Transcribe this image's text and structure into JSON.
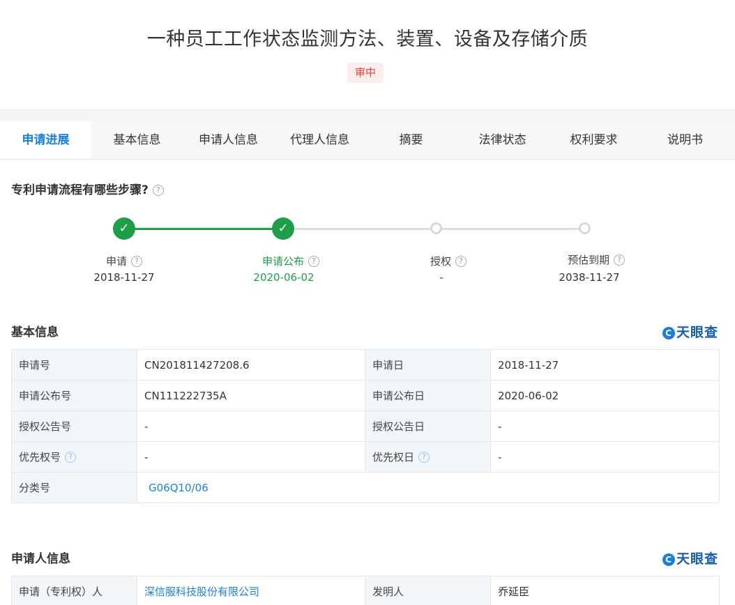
{
  "header": {
    "title": "一种员工工作状态监测方法、装置、设备及存储介质",
    "status_badge": "审中"
  },
  "tabs": [
    {
      "label": "申请进展",
      "active": true
    },
    {
      "label": "基本信息"
    },
    {
      "label": "申请人信息"
    },
    {
      "label": "代理人信息"
    },
    {
      "label": "摘要"
    },
    {
      "label": "法律状态"
    },
    {
      "label": "权利要求"
    },
    {
      "label": "说明书"
    }
  ],
  "progress": {
    "heading": "专利申请流程有哪些步骤?",
    "steps": [
      {
        "label": "申请",
        "date": "2018-11-27",
        "done": true
      },
      {
        "label": "申请公布",
        "date": "2020-06-02",
        "done": true
      },
      {
        "label": "授权",
        "date": "-",
        "done": false
      },
      {
        "label": "预估到期",
        "date": "2038-11-27",
        "done": false
      }
    ],
    "help_glyph": "?",
    "check_glyph": "✓"
  },
  "basic_info": {
    "heading": "基本信息",
    "logo_text": "天眼查",
    "logo_mark": "C",
    "rows": [
      {
        "k1": "申请号",
        "v1": "CN201811427208.6",
        "k2": "申请日",
        "v2": "2018-11-27"
      },
      {
        "k1": "申请公布号",
        "v1": "CN111222735A",
        "k2": "申请公布日",
        "v2": "2020-06-02"
      },
      {
        "k1": "授权公告号",
        "v1": "-",
        "k2": "授权公告日",
        "v2": "-"
      },
      {
        "k1": "优先权号",
        "v1": "-",
        "k2": "优先权日",
        "v2": "-"
      },
      {
        "k1": "分类号",
        "v1": "G06Q10/06"
      }
    ]
  },
  "applicant_info": {
    "heading": "申请人信息",
    "logo_text": "天眼查",
    "rows": [
      {
        "k1": "申请（专利权）人",
        "v1": "深信服科技股份有限公司",
        "k2": "发明人",
        "v2": "乔延臣"
      }
    ]
  },
  "colors": {
    "accent_blue": "#1a7fd6",
    "done_green": "#1f9e47",
    "badge_red": "#e2453c",
    "key_cell_bg": "#f1f6fb"
  }
}
